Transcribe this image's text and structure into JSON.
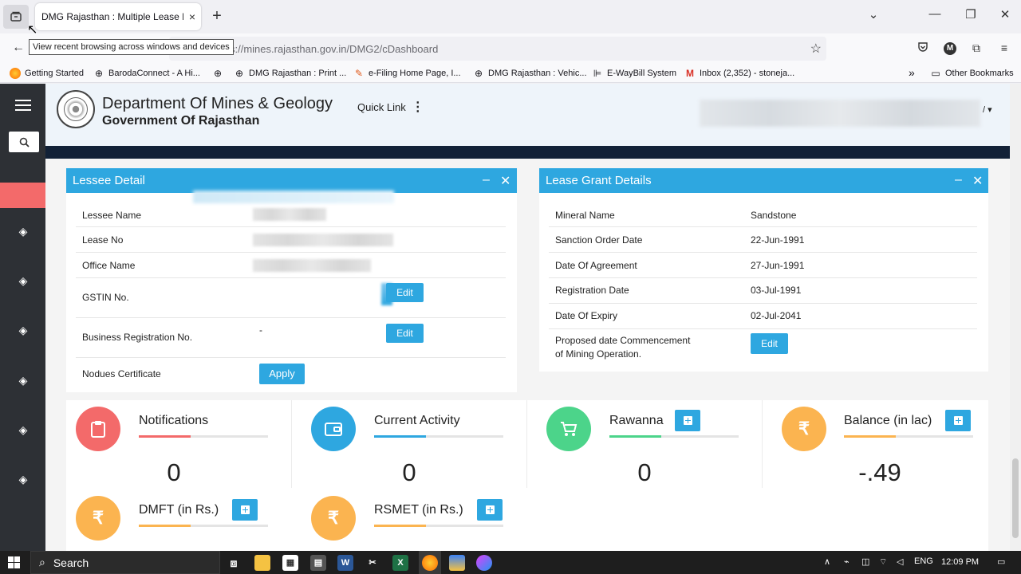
{
  "browser": {
    "tab_title": "DMG Rajasthan : Multiple Lease Das",
    "tab_close": "×",
    "new_tab": "+",
    "tooltip": "View recent browsing across windows and devices",
    "url": "s://mines.rajasthan.gov.in/DMG2/cDashboard",
    "bookmarks": [
      {
        "label": "Getting Started",
        "icon": "firefox-icon"
      },
      {
        "label": "BarodaConnect - A Hi...",
        "icon": "globe-icon"
      },
      {
        "label": "",
        "icon": "globe-icon"
      },
      {
        "label": "DMG Rajasthan : Print ...",
        "icon": "globe-icon"
      },
      {
        "label": "e-Filing Home Page, I...",
        "icon": "efiling-icon"
      },
      {
        "label": "DMG Rajasthan : Vehic...",
        "icon": "globe-icon"
      },
      {
        "label": "E-WayBill System",
        "icon": "ewaybill-icon"
      },
      {
        "label": "Inbox (2,352) - stoneja...",
        "icon": "gmail-icon"
      }
    ],
    "other_bookmarks": "Other Bookmarks"
  },
  "header": {
    "dept_title": "Department Of Mines & Geology",
    "gov_title": "Government Of Rajasthan",
    "quick_link": "Quick Link",
    "user_caret": "/ ▾"
  },
  "lessee_panel": {
    "title": "Lessee Detail",
    "rows": [
      {
        "label": "Lessee Name",
        "value": ""
      },
      {
        "label": "Lease No",
        "value": ""
      },
      {
        "label": "Office Name",
        "value": ""
      },
      {
        "label": "GSTIN No.",
        "value": ""
      },
      {
        "label": "Business Registration No.",
        "value": "-"
      },
      {
        "label": "Nodues Certificate",
        "value": ""
      }
    ],
    "edit_label": "Edit",
    "apply_label": "Apply"
  },
  "lease_panel": {
    "title": "Lease Grant Details",
    "rows": [
      {
        "label": "Mineral Name",
        "value": "Sandstone"
      },
      {
        "label": "Sanction Order Date",
        "value": "22-Jun-1991"
      },
      {
        "label": "Date Of Agreement",
        "value": "27-Jun-1991"
      },
      {
        "label": "Registration Date",
        "value": "03-Jul-1991"
      },
      {
        "label": "Date Of Expiry",
        "value": "02-Jul-2041"
      },
      {
        "label": "Proposed date Commencement",
        "label2": "of Mining Operation.",
        "value": ""
      }
    ],
    "edit_label": "Edit"
  },
  "stats": [
    {
      "title": "Notifications",
      "value": "0",
      "color": "#f36a6a",
      "icon": "clipboard-icon"
    },
    {
      "title": "Current Activity",
      "value": "0",
      "color": "#2ea7e0",
      "icon": "wallet-icon"
    },
    {
      "title": "Rawanna",
      "value": "0",
      "color": "#4cd48a",
      "icon": "cart-icon"
    },
    {
      "title": "Balance (in lac)",
      "value": "-.49",
      "color": "#fbb450",
      "icon": "rupee-icon"
    },
    {
      "title": "DMFT (in Rs.)",
      "value": "",
      "color": "#fbb450",
      "icon": "rupee-icon"
    },
    {
      "title": "RSMET (in Rs.)",
      "value": "",
      "color": "#fbb450",
      "icon": "rupee-icon"
    }
  ],
  "rupee_symbol": "₹",
  "taskbar": {
    "search": "Search",
    "lang": "ENG",
    "time": "12:09 PM"
  }
}
